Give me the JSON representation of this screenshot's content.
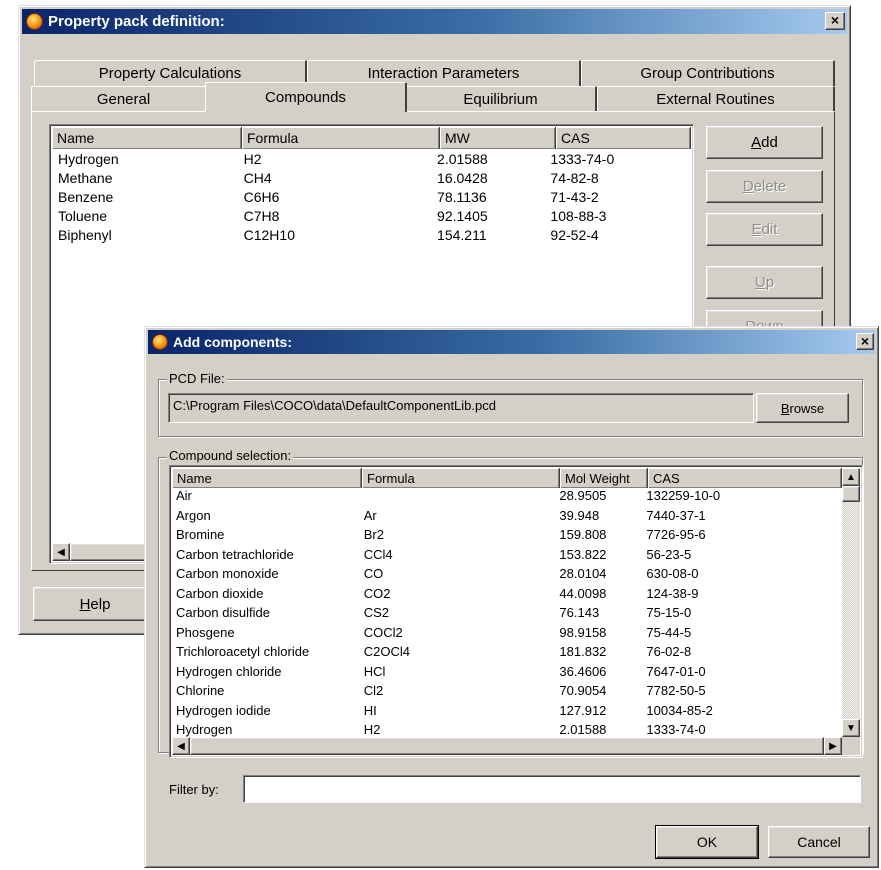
{
  "main_window": {
    "title": "Property pack definition:",
    "close_glyph": "×",
    "tabs_row1": [
      "Property Calculations",
      "Interaction Parameters",
      "Group Contributions"
    ],
    "tabs_row2": [
      "General",
      "Compounds",
      "Equilibrium",
      "External Routines"
    ],
    "active_tab": "Compounds",
    "list_columns": [
      "Name",
      "Formula",
      "MW",
      "CAS"
    ],
    "compounds": [
      {
        "name": "Hydrogen",
        "formula": "H2",
        "mw": "2.01588",
        "cas": "1333-74-0"
      },
      {
        "name": "Methane",
        "formula": "CH4",
        "mw": "16.0428",
        "cas": "74-82-8"
      },
      {
        "name": "Benzene",
        "formula": "C6H6",
        "mw": "78.1136",
        "cas": "71-43-2"
      },
      {
        "name": "Toluene",
        "formula": "C7H8",
        "mw": "92.1405",
        "cas": "108-88-3"
      },
      {
        "name": "Biphenyl",
        "formula": "C12H10",
        "mw": "154.211",
        "cas": "92-52-4"
      }
    ],
    "buttons": {
      "add": {
        "accel": "A",
        "rest": "dd"
      },
      "delete": {
        "accel": "D",
        "rest": "elete"
      },
      "edit": {
        "accel": "E",
        "rest": "dit"
      },
      "up": {
        "accel": "U",
        "rest": "p"
      },
      "down": {
        "text": "Down"
      },
      "help": {
        "accel": "H",
        "rest": "elp"
      }
    }
  },
  "add_dialog": {
    "title": "Add components:",
    "close_glyph": "×",
    "pcd_group_label": "PCD File:",
    "pcd_path": "C:\\Program Files\\COCO\\data\\DefaultComponentLib.pcd",
    "browse": {
      "accel": "B",
      "rest": "rowse"
    },
    "selection_group_label": "Compound selection:",
    "list_columns": [
      "Name",
      "Formula",
      "Mol Weight",
      "CAS"
    ],
    "components": [
      {
        "name": "Air",
        "formula": "",
        "mw": "28.9505",
        "cas": "132259-10-0"
      },
      {
        "name": "Argon",
        "formula": "Ar",
        "mw": "39.948",
        "cas": "7440-37-1"
      },
      {
        "name": "Bromine",
        "formula": "Br2",
        "mw": "159.808",
        "cas": "7726-95-6"
      },
      {
        "name": "Carbon tetrachloride",
        "formula": "CCl4",
        "mw": "153.822",
        "cas": "56-23-5"
      },
      {
        "name": "Carbon monoxide",
        "formula": "CO",
        "mw": "28.0104",
        "cas": "630-08-0"
      },
      {
        "name": "Carbon dioxide",
        "formula": "CO2",
        "mw": "44.0098",
        "cas": "124-38-9"
      },
      {
        "name": "Carbon disulfide",
        "formula": "CS2",
        "mw": "76.143",
        "cas": "75-15-0"
      },
      {
        "name": "Phosgene",
        "formula": "COCl2",
        "mw": "98.9158",
        "cas": "75-44-5"
      },
      {
        "name": "Trichloroacetyl chloride",
        "formula": "C2OCl4",
        "mw": "181.832",
        "cas": "76-02-8"
      },
      {
        "name": "Hydrogen chloride",
        "formula": "HCl",
        "mw": "36.4606",
        "cas": "7647-01-0"
      },
      {
        "name": "Chlorine",
        "formula": "Cl2",
        "mw": "70.9054",
        "cas": "7782-50-5"
      },
      {
        "name": "Hydrogen iodide",
        "formula": "HI",
        "mw": "127.912",
        "cas": "10034-85-2"
      },
      {
        "name": "Hydrogen",
        "formula": "H2",
        "mw": "2.01588",
        "cas": "1333-74-0"
      }
    ],
    "filter_label": "Filter by:",
    "filter_value": "",
    "ok_label": "OK",
    "cancel_label": "Cancel"
  },
  "icons": {
    "app": "app-icon",
    "close": "close-icon",
    "scroll_up": "arrow-up-icon",
    "scroll_down": "arrow-down-icon",
    "scroll_left": "arrow-left-icon",
    "scroll_right": "arrow-right-icon"
  },
  "colors": {
    "titlebar_start": "#0a246a",
    "titlebar_end": "#a6caf0",
    "face": "#d4d0c8"
  }
}
